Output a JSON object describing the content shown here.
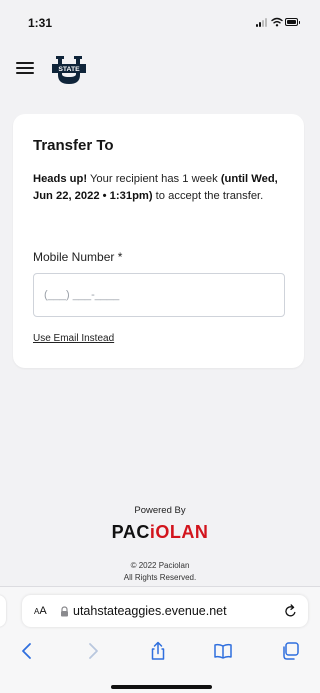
{
  "status_bar": {
    "time": "1:31"
  },
  "header": {
    "menu_icon": "hamburger-menu-icon",
    "logo_icon": "utah-state-logo-icon",
    "logo_text": "STATE"
  },
  "transfer_card": {
    "title": "Transfer To",
    "notice_heads_up": "Heads up!",
    "notice_text_1": " Your recipient has 1 week ",
    "notice_deadline": "(until Wed, Jun 22, 2022 • 1:31pm)",
    "notice_text_2": " to accept the transfer.",
    "mobile_label": "Mobile Number *",
    "mobile_placeholder": "(___) ___-____",
    "mobile_value": "",
    "use_email_link": "Use Email Instead"
  },
  "footer": {
    "powered_by": "Powered By",
    "brand_part1": "PAC",
    "brand_part2": "iOLAN",
    "copyright_line1": "© 2022 Paciolan",
    "copyright_line2": "All Rights Reserved."
  },
  "browser": {
    "aa_label_small": "A",
    "aa_label_large": "A",
    "url": "utahstateaggies.evenue.net",
    "nav_icons": [
      "back-icon",
      "forward-icon",
      "share-icon",
      "bookmarks-icon",
      "tabs-icon"
    ]
  },
  "colors": {
    "accent_red": "#d2141c",
    "page_bg": "#f2f2f4",
    "card_bg": "#ffffff",
    "logo_navy": "#0f2439"
  }
}
